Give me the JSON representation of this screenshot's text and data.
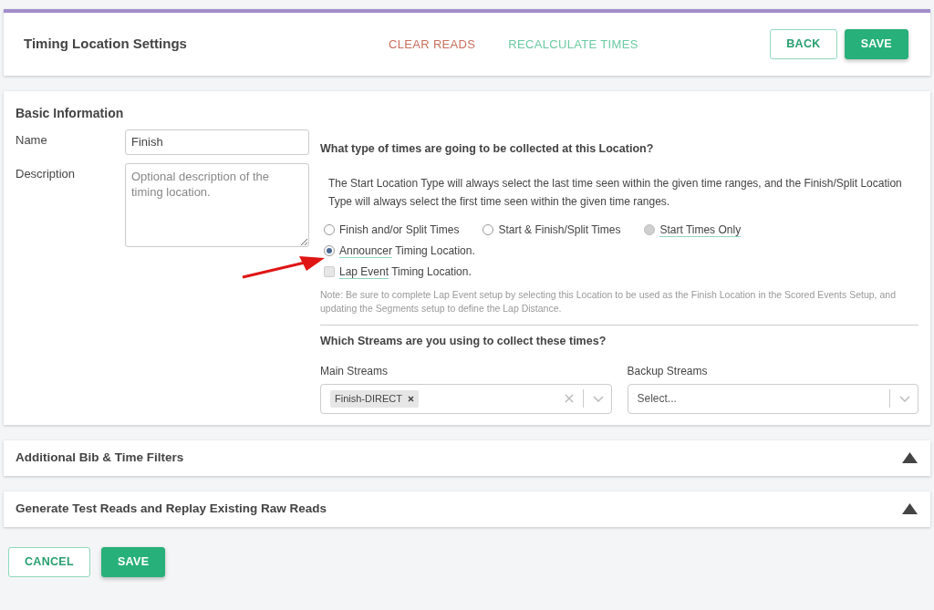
{
  "header": {
    "title": "Timing Location Settings",
    "actions": [
      {
        "label": "CLEAR READS",
        "kind": "danger"
      },
      {
        "label": "RECALCULATE TIMES",
        "kind": "info"
      }
    ],
    "buttons": [
      {
        "label": "BACK",
        "kind": "outline"
      },
      {
        "label": "SAVE",
        "kind": "solid"
      }
    ]
  },
  "basic": {
    "title": "Basic Information",
    "name_label": "Name",
    "name_value": "Finish",
    "description_label": "Description",
    "description_placeholder": "Optional description of the timing location."
  },
  "times": {
    "question": "What type of times are going to be collected at this Location?",
    "explanation": "The Start Location Type will always select the last time seen within the given time ranges, and the Finish/Split Location Type will always select the first time seen within the given time ranges.",
    "option_rows": [
      [
        {
          "kind": "radio",
          "rest": "Finish and/or Split Times",
          "selected": false,
          "disabled": false
        },
        {
          "kind": "radio",
          "rest": "Start & Finish/Split Times",
          "selected": false,
          "disabled": false
        },
        {
          "kind": "radio",
          "term": "Start Times Only",
          "selected": false,
          "disabled": true
        }
      ],
      [
        {
          "kind": "radio",
          "term": "Announcer",
          "rest": " Timing Location.",
          "selected": true,
          "disabled": false
        }
      ],
      [
        {
          "kind": "checkbox",
          "term": "Lap Event",
          "rest": " Timing Location.",
          "selected": false
        }
      ]
    ],
    "note": "Note: Be sure to complete Lap Event setup by selecting this Location to be used as the Finish Location in the Scored Events Setup, and updating the Segments setup to define the Lap Distance."
  },
  "streams": {
    "question": "Which Streams are you using to collect these times?",
    "main_label": "Main Streams",
    "main_tags": [
      "Finish-DIRECT"
    ],
    "backup_label": "Backup Streams",
    "backup_placeholder": "Select..."
  },
  "sections": [
    {
      "title": "Additional Bib & Time Filters",
      "expanded": false
    },
    {
      "title": "Generate Test Reads and Replay Existing Raw Reads",
      "expanded": false
    }
  ],
  "footer_buttons": [
    {
      "label": "CANCEL",
      "kind": "outline"
    },
    {
      "label": "SAVE",
      "kind": "solid"
    }
  ]
}
